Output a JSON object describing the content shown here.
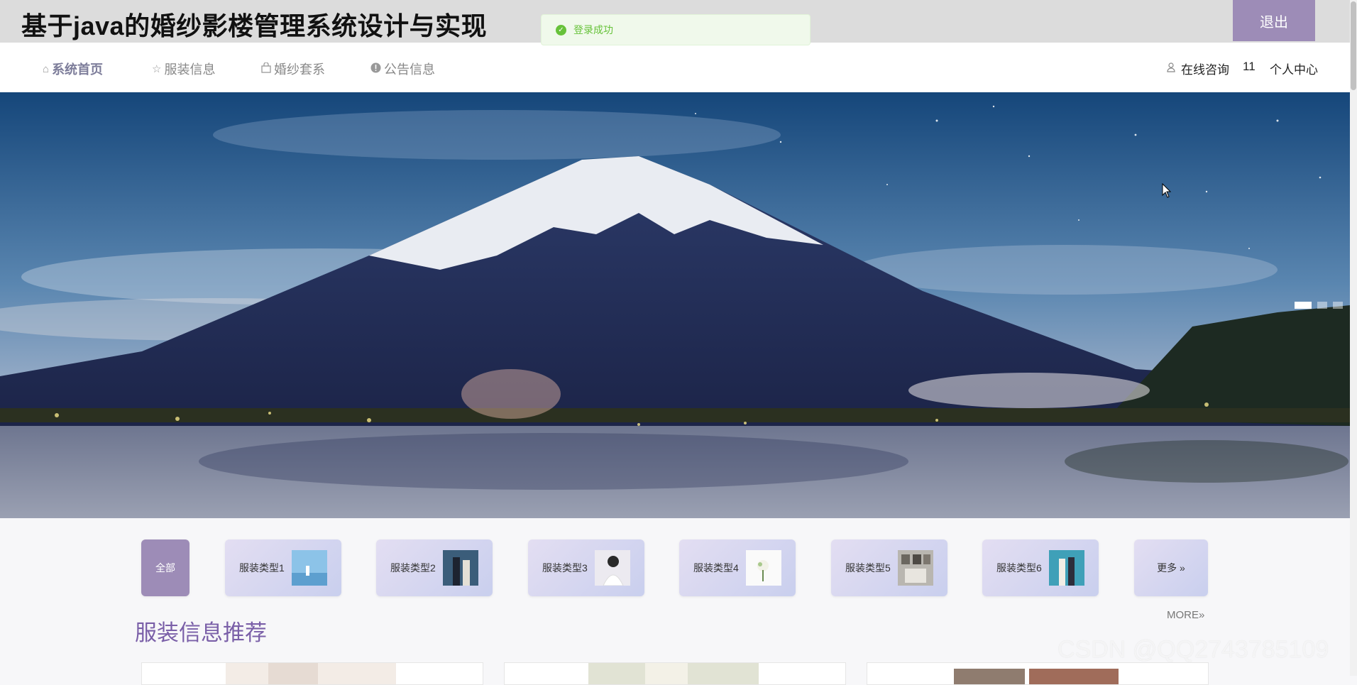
{
  "header": {
    "title": "基于java的婚纱影楼管理系统设计与实现",
    "logout_label": "退出",
    "toast": "登录成功"
  },
  "nav": {
    "items": [
      {
        "label": "系统首页",
        "icon": "home-icon",
        "active": true
      },
      {
        "label": "服装信息",
        "icon": "star-icon",
        "active": false
      },
      {
        "label": "婚纱套系",
        "icon": "bag-icon",
        "active": false
      },
      {
        "label": "公告信息",
        "icon": "info-icon",
        "active": false
      }
    ],
    "consult_label": "在线咨询",
    "user_name": "11",
    "profile_label": "个人中心"
  },
  "banner": {
    "slide_count": 3,
    "active_slide": 1
  },
  "categories": {
    "all_label": "全部",
    "items": [
      {
        "label": "服装类型1"
      },
      {
        "label": "服装类型2"
      },
      {
        "label": "服装类型3"
      },
      {
        "label": "服装类型4"
      },
      {
        "label": "服装类型5"
      },
      {
        "label": "服装类型6"
      }
    ],
    "more_label": "更多 »"
  },
  "section": {
    "more_link": "MORE»",
    "title": "服装信息推荐"
  },
  "watermark": "CSDN @QQ2743785109",
  "colors": {
    "accent": "#9d8cb7",
    "section_title": "#7a5fa8",
    "toast_green": "#67c23a"
  }
}
